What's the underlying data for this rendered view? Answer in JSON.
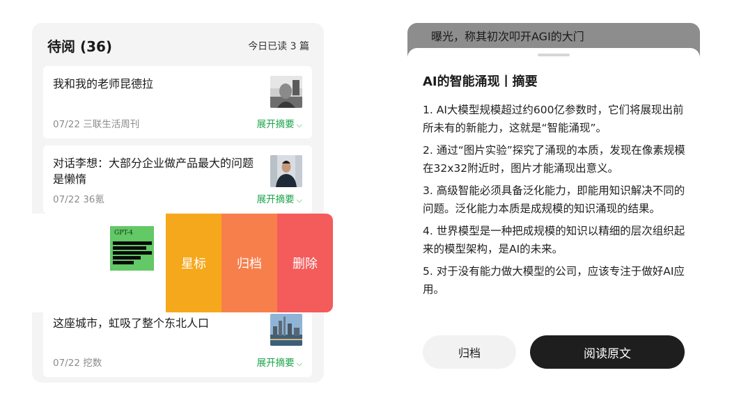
{
  "reading_list": {
    "title": "待阅 (36)",
    "today_read": "今日已读 3 篇",
    "expand_label": "展开摘要",
    "articles": [
      {
        "title": "我和我的老师昆德拉",
        "meta": "07/22 三联生活周刊"
      },
      {
        "title": "对话李想：大部分企业做产品最大的问题是懒惰",
        "meta": "07/22 36氪"
      },
      {
        "title": "这座城市，虹吸了整个东北人口",
        "meta": "07/22 挖数"
      }
    ],
    "swipe_item": {
      "thumbnail_text": "GPT-4",
      "actions": [
        "星标",
        "归档",
        "删除"
      ]
    }
  },
  "summary_sheet": {
    "background_text": "曝光，称其初次叩开AGI的大门",
    "title": "AI的智能涌现丨摘要",
    "points": [
      "1. AI大模型规模超过约600亿参数时，它们将展现出前所未有的新能力，这就是“智能涌现”。",
      "2. 通过“图片实验”探究了涌现的本质，发现在像素规模在32x32附近时，图片才能涌现出意义。",
      "3. 高级智能必须具备泛化能力，即能用知识解决不同的问题。泛化能力本质是成规模的知识涌现的结果。",
      "4. 世界模型是一种把成规模的知识以精细的层次组织起来的模型架构，是AI的未来。",
      "5. 对于没有能力做大模型的公司，应该专注于做好AI应用。"
    ],
    "archive_button": "归档",
    "read_button": "阅读原文"
  },
  "colors": {
    "accent_green": "#1aa34a",
    "star": "#f6a81c",
    "archive": "#f77f4c",
    "delete": "#f45b5b"
  }
}
